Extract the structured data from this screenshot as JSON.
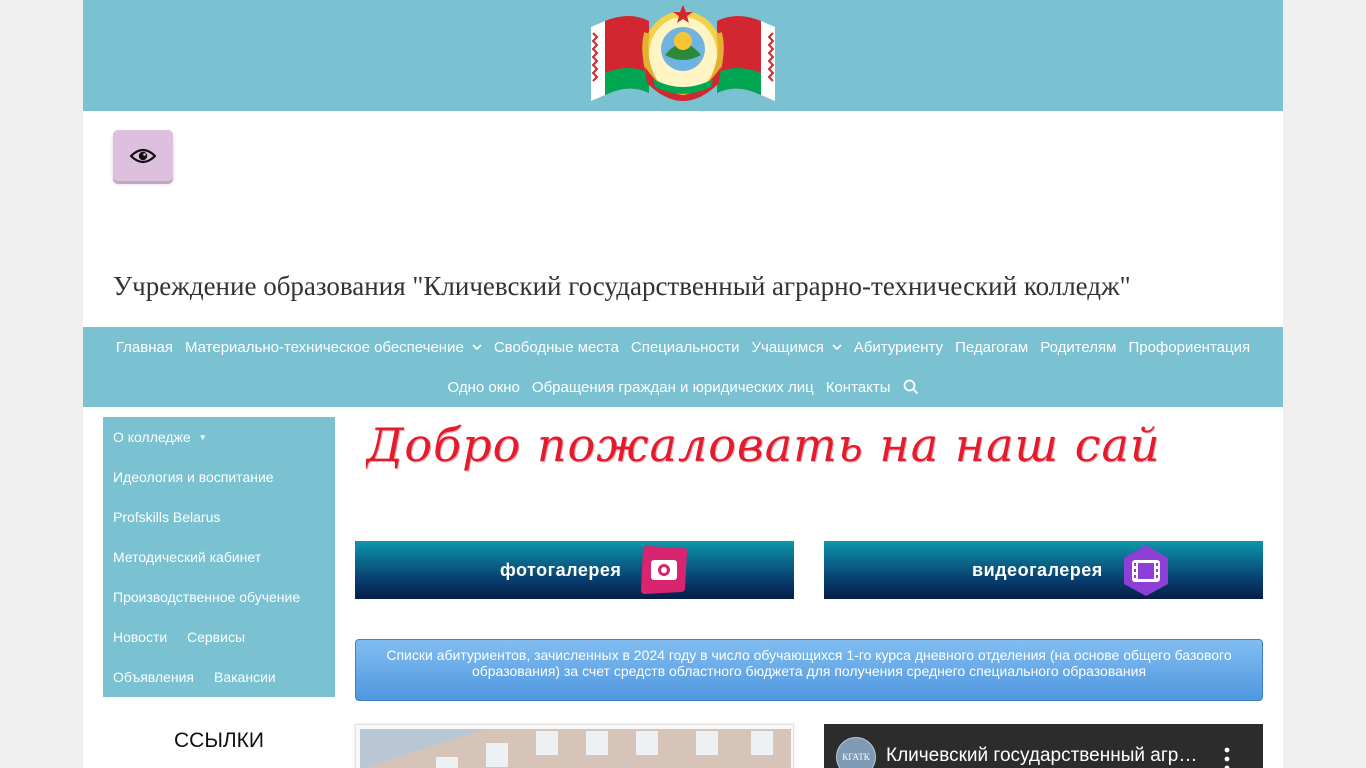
{
  "site_title": "Учреждение образования \"Кличевский государственный аграрно-технический колледж\"",
  "emblem_icon": "belarus-emblem-flags",
  "accessibility_button": {
    "icon": "eye-icon"
  },
  "nav": {
    "row1": [
      {
        "label": "Главная",
        "has_dropdown": false
      },
      {
        "label": "Материально-техническое обеспечение",
        "has_dropdown": true
      },
      {
        "label": "Свободные места",
        "has_dropdown": false
      },
      {
        "label": "Специальности",
        "has_dropdown": false
      },
      {
        "label": "Учащимся",
        "has_dropdown": true
      },
      {
        "label": "Абитуриенту",
        "has_dropdown": false
      },
      {
        "label": "Педагогам",
        "has_dropdown": false
      },
      {
        "label": "Родителям",
        "has_dropdown": false
      },
      {
        "label": "Профориентация",
        "has_dropdown": false
      }
    ],
    "row2": [
      {
        "label": "Одно окно",
        "has_dropdown": false
      },
      {
        "label": "Обращения граждан и юридических лиц",
        "has_dropdown": false
      },
      {
        "label": "Контакты",
        "has_dropdown": false
      }
    ],
    "search_icon": "search-icon"
  },
  "sidebar": {
    "items": {
      "about": "О колледже",
      "ideology": "Идеология и воспитание",
      "profskills": "Profskills Belarus",
      "methodical": "Методический кабинет",
      "production": "Производственное обучение",
      "news": "Новости",
      "services": "Сервисы",
      "announcements": "Объявления",
      "vacancies": "Вакансии"
    },
    "links_title": "ССЫЛКИ"
  },
  "welcome_text": "Добро пожаловать на наш сай",
  "galleries": {
    "photo": {
      "label": "фотогалерея",
      "icon": "camera-icon"
    },
    "video": {
      "label": "видеогалерея",
      "icon": "film-icon"
    }
  },
  "notice": "Списки абитуриентов, зачисленных в 2024 году в число обучающихся 1-го курса дневного отделения (на основе общего базового образования) за счет средств областного бюджета для получения среднего специального образования",
  "video": {
    "channel_avatar": "КГАТК",
    "title": "Кличевский государственный аграрно-технический колледж"
  },
  "colors": {
    "band": "#7ac1d1",
    "accessibility_button": "#dcc0dd",
    "welcome": "#e21b2d",
    "notice": "#5b9fe4",
    "flag_red": "#d22730",
    "flag_green": "#00a651"
  }
}
